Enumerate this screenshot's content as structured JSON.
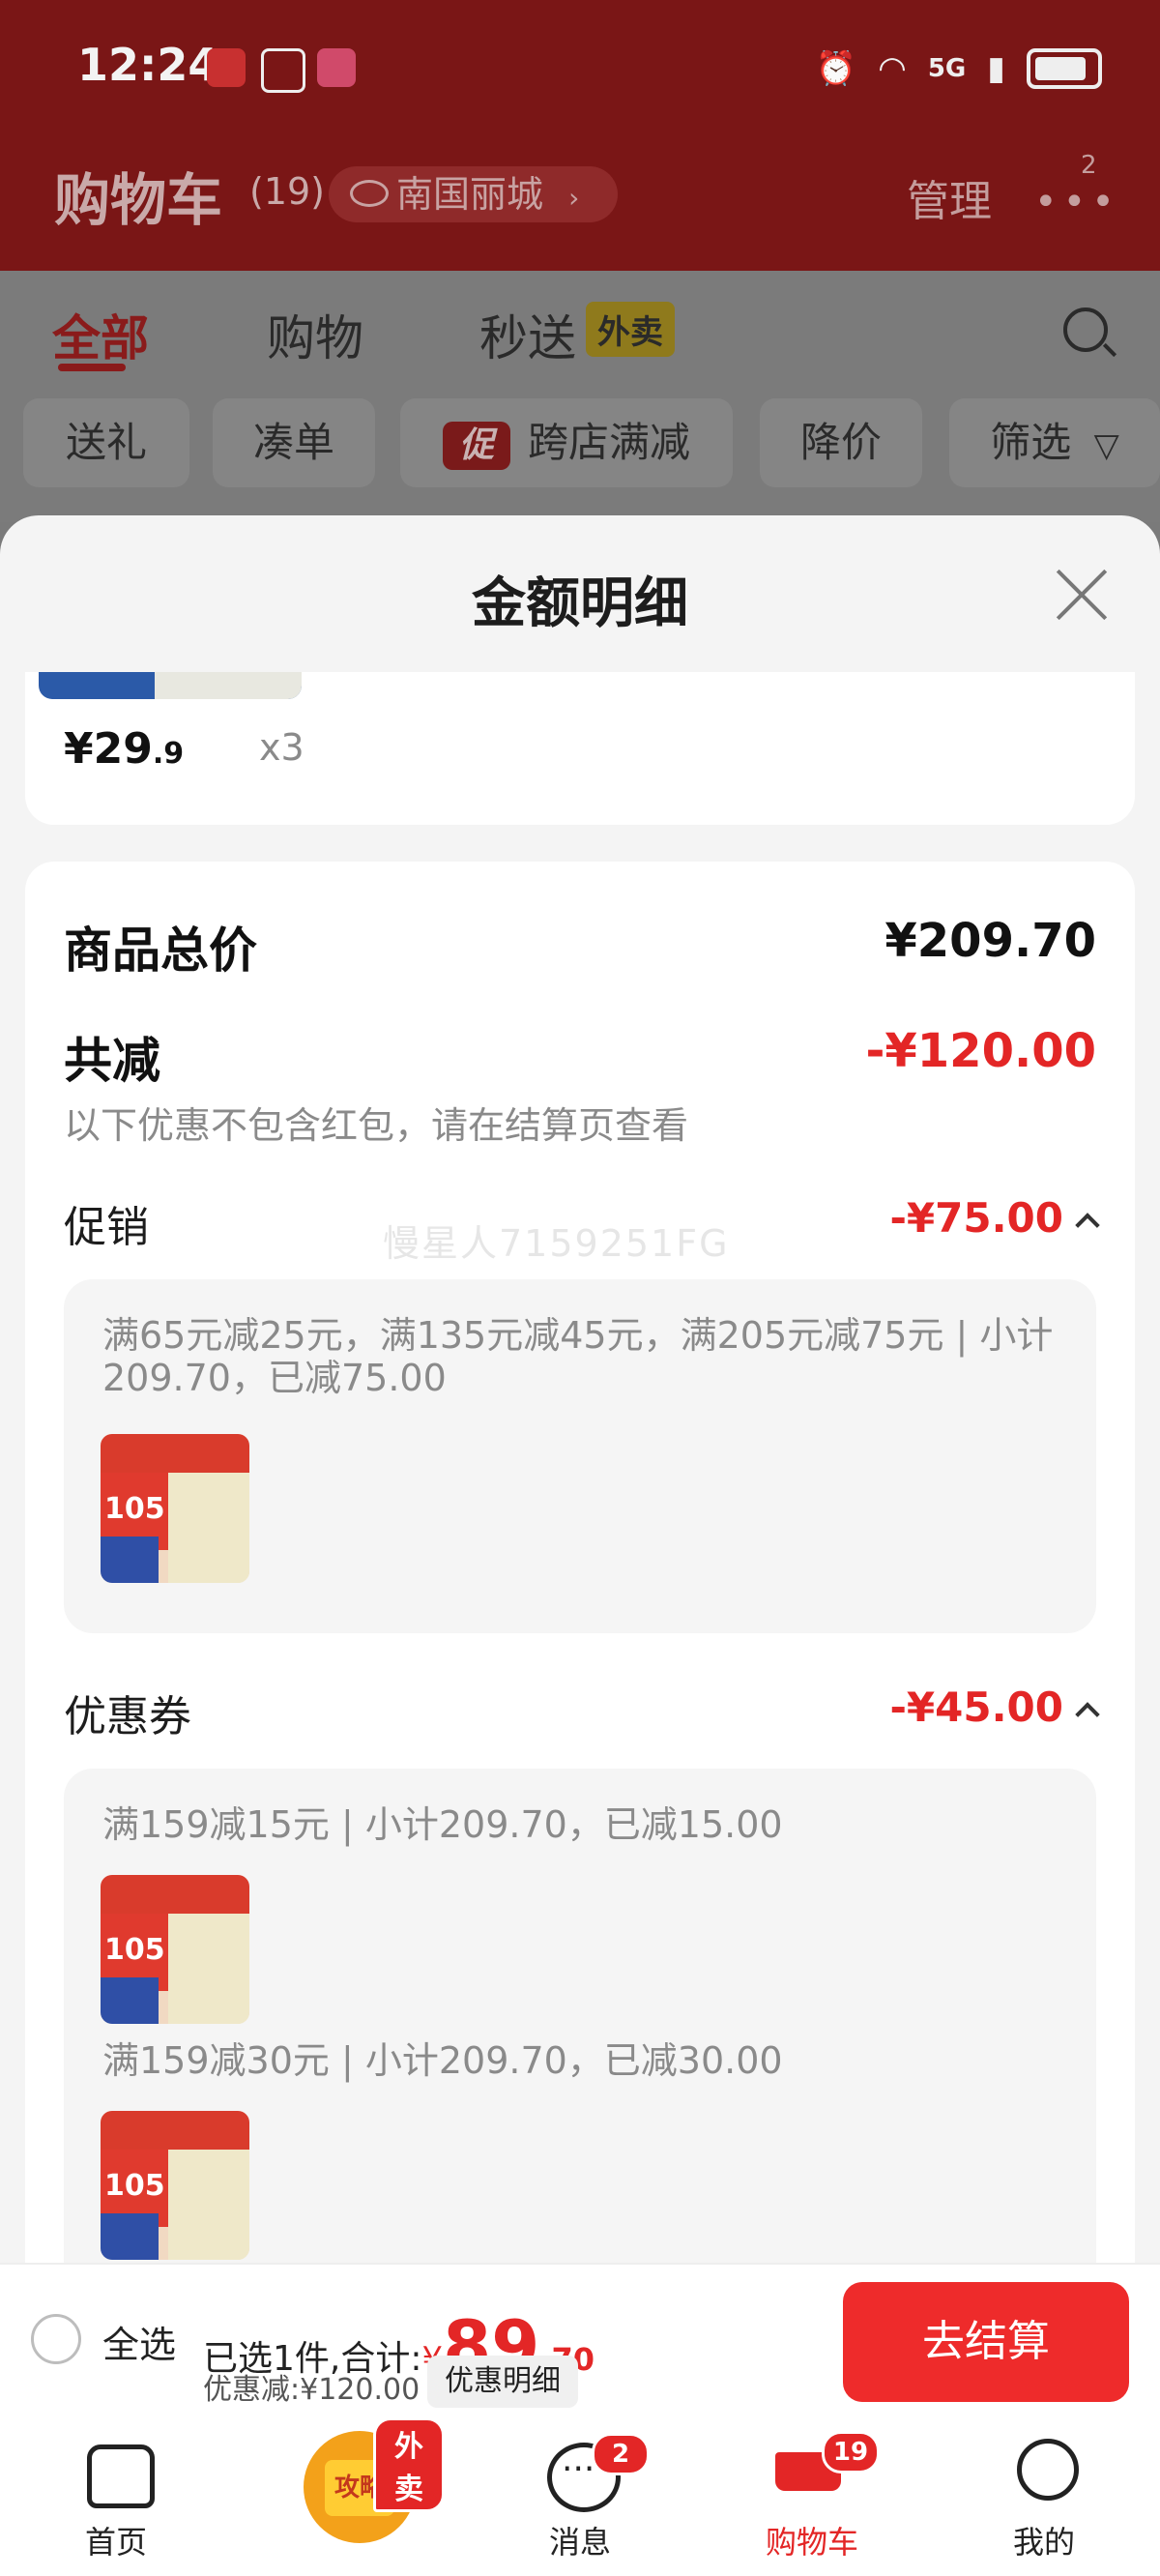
{
  "status_bar": {
    "time": "12:24",
    "network": "5G"
  },
  "header": {
    "title": "购物车",
    "count": "(19)",
    "location": "南国丽城",
    "manage": "管理",
    "more_badge": "2"
  },
  "tabs": [
    {
      "label": "全部"
    },
    {
      "label": "购物"
    },
    {
      "label": "秒送",
      "tag": "外卖"
    }
  ],
  "filters": {
    "gift": "送礼",
    "bundle": "凑单",
    "promo_mark": "促",
    "cross_store": "跨店满减",
    "price_drop": "降价",
    "filter": "筛选"
  },
  "sheet": {
    "title": "金额明细",
    "product_price": {
      "currency": "¥",
      "integer": "29",
      "decimal": ".9"
    },
    "product_qty": "x3",
    "total_label": "商品总价",
    "total_value": "¥209.70",
    "reduction_label": "共减",
    "reduction_value": "-¥120.00",
    "reduction_note": "以下优惠不包含红包，请在结算页查看",
    "promo_label": "促销",
    "promo_value": "-¥75.00",
    "promo_rule": "满65元减25元，满135元减45元，满205元减75元 | 小计209.70，已减75.00",
    "watermark": "慢星人7159251FG",
    "coupon_label": "优惠券",
    "coupon_value": "-¥45.00",
    "coupon_rule_1": "满159减15元 | 小计209.70，已减15.00",
    "coupon_rule_2": "满159减30元 | 小计209.70，已减30.00",
    "thumb_text": "105"
  },
  "checkout": {
    "select_all": "全选",
    "selected_prefix": "已选1件,合计:",
    "currency": "¥",
    "total_int": "89",
    "total_dec": ".70",
    "discount": "优惠减:¥120.00",
    "detail_button": "优惠明细",
    "checkout_button": "去结算"
  },
  "nav": {
    "home": "首页",
    "guide": "攻略",
    "guide_badge": "外卖",
    "messages": "消息",
    "messages_badge": "2",
    "cart": "购物车",
    "cart_badge": "19",
    "me": "我的"
  },
  "colors": {
    "accent_red": "#e32626",
    "checkout_red": "#ee2b2b",
    "header_bg": "#7a1616"
  }
}
